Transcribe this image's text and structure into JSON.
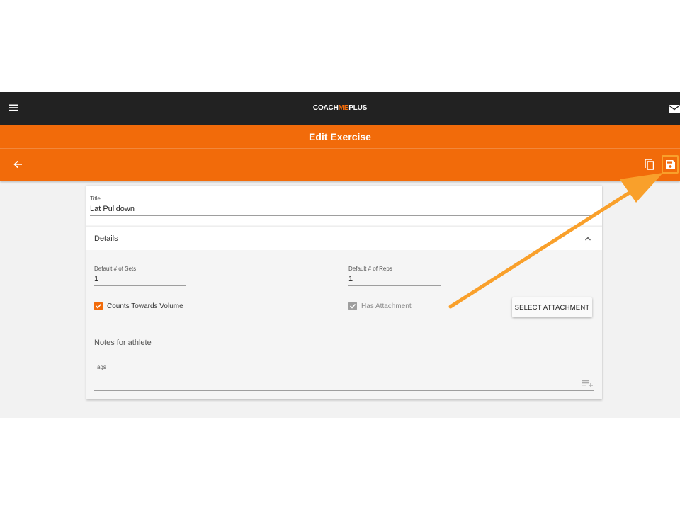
{
  "app": {
    "brand": {
      "part1": "COACH",
      "part2": "ME",
      "part3": "PLUS"
    },
    "page_title": "Edit Exercise"
  },
  "icons": {
    "menu": "menu-icon",
    "mail": "mail-icon",
    "back": "arrow-left-icon",
    "copy": "copy-icon",
    "save": "floppy-disk-icon",
    "collapse": "chevron-up-icon",
    "tags_add": "playlist-add-icon"
  },
  "form": {
    "title_label": "Title",
    "title_value": "Lat Pulldown",
    "details_label": "Details",
    "sets_label": "Default # of Sets",
    "sets_value": "1",
    "reps_label": "Default # of Reps",
    "reps_value": "1",
    "counts_volume_label": "Counts Towards Volume",
    "counts_volume_checked": true,
    "has_attachment_label": "Has Attachment",
    "has_attachment_checked": true,
    "select_attachment_label": "SELECT ATTACHMENT",
    "notes_placeholder": "Notes for athlete",
    "tags_label": "Tags"
  },
  "colors": {
    "brand_orange": "#f26b0a",
    "topbar": "#222222",
    "annotation_arrow": "#f9a02b"
  }
}
